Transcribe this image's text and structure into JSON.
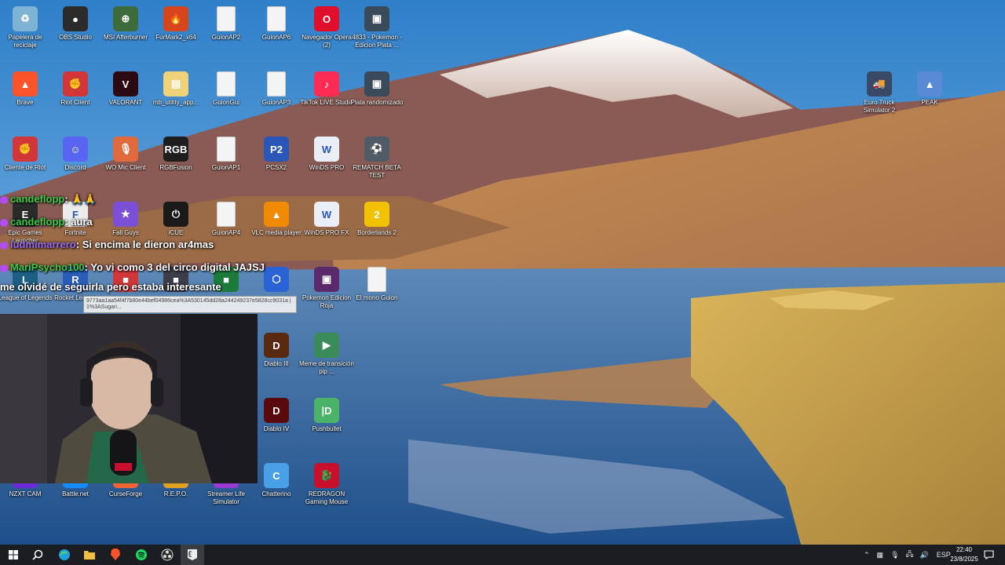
{
  "desktop": {
    "icons": [
      {
        "label": "Papelera de reciclaje",
        "icon": "recycle-bin-icon",
        "color": "#7fb3d6"
      },
      {
        "label": "OBS Studio",
        "icon": "obs-icon",
        "color": "#2b2b2b"
      },
      {
        "label": "MSI Afterburner",
        "icon": "msi-afterburner-icon",
        "color": "#3d6b3a"
      },
      {
        "label": "FurMark2_x64",
        "icon": "furmark-icon",
        "color": "#d6461c"
      },
      {
        "label": "GuionAP2",
        "icon": "file-icon",
        "color": "#f4f4f4"
      },
      {
        "label": "GuionAP6",
        "icon": "file-icon",
        "color": "#f4f4f4"
      },
      {
        "label": "Navegador Opera (2)",
        "icon": "opera-icon",
        "color": "#e0102d"
      },
      {
        "label": "4833 - Pokemon - Edicion Plata ...",
        "icon": "rom-icon",
        "color": "#3a4a5a"
      },
      {
        "label": "Brave",
        "icon": "brave-icon",
        "color": "#fb542b"
      },
      {
        "label": "Riot Client",
        "icon": "riot-client-icon",
        "color": "#d13639"
      },
      {
        "label": "VALORANT",
        "icon": "valorant-icon",
        "color": "#2b0a13"
      },
      {
        "label": "mb_utility_app...",
        "icon": "folder-zip-icon",
        "color": "#f0d27a"
      },
      {
        "label": "GuionGui",
        "icon": "file-icon",
        "color": "#f4f4f4"
      },
      {
        "label": "GuionAP3",
        "icon": "file-icon",
        "color": "#f4f4f4"
      },
      {
        "label": "TikTok LIVE Studio",
        "icon": "tiktok-live-icon",
        "color": "#fe2c55"
      },
      {
        "label": "Plata randomizado",
        "icon": "rom-icon",
        "color": "#3a4a5a"
      },
      {
        "label": "Cliente de Riot",
        "icon": "riot-client-icon",
        "color": "#d13639"
      },
      {
        "label": "Discord",
        "icon": "discord-icon",
        "color": "#5865f2"
      },
      {
        "label": "WO Mic Client",
        "icon": "microphone-icon",
        "color": "#e06a3b"
      },
      {
        "label": "RGBFusion",
        "icon": "rgb-fusion-icon",
        "color": "#1e1e1e"
      },
      {
        "label": "GuionAP1",
        "icon": "file-icon",
        "color": "#f4f4f4"
      },
      {
        "label": "PCSX2",
        "icon": "pcsx2-icon",
        "color": "#2a56b8"
      },
      {
        "label": "WinDS PRO",
        "icon": "winds-icon",
        "color": "#e9eef7"
      },
      {
        "label": "REMATCH BETA TEST",
        "icon": "rematch-icon",
        "color": "#4f5b66"
      },
      {
        "label": "Epic Games Launcher",
        "icon": "epic-games-icon",
        "color": "#2a2a2a"
      },
      {
        "label": "Fortnite",
        "icon": "fortnite-icon",
        "color": "#ececec"
      },
      {
        "label": "Fall Guys",
        "icon": "fall-guys-icon",
        "color": "#7b4fd6"
      },
      {
        "label": "iCUE",
        "icon": "icue-icon",
        "color": "#1a1a1a"
      },
      {
        "label": "GuionAP4",
        "icon": "file-icon",
        "color": "#f4f4f4"
      },
      {
        "label": "VLC media player",
        "icon": "vlc-icon",
        "color": "#f08a00"
      },
      {
        "label": "WinDS PRO FX",
        "icon": "winds-icon",
        "color": "#e9eef7"
      },
      {
        "label": "Borderlands 2",
        "icon": "borderlands-icon",
        "color": "#f2c200"
      },
      {
        "label": "League of Legends",
        "icon": "league-icon",
        "color": "#1c5f83"
      },
      {
        "label": "Rocket League",
        "icon": "rocket-league-icon",
        "color": "#2a5db8"
      },
      {
        "label": "",
        "icon": "app-red-icon",
        "color": "#d13639"
      },
      {
        "label": "",
        "icon": "app-dark-icon",
        "color": "#3c3c4a"
      },
      {
        "label": "",
        "icon": "app-green-icon",
        "color": "#1c7a3a"
      },
      {
        "label": "",
        "icon": "box-3d-icon",
        "color": "#2a63d6"
      },
      {
        "label": "Pokemon Edicion Roja",
        "icon": "rom-icon",
        "color": "#5a2a6a"
      },
      {
        "label": "El mono Guion",
        "icon": "file-icon",
        "color": "#f4f4f4"
      },
      {
        "label": "Diablo III",
        "icon": "diablo3-icon",
        "color": "#5a2a10"
      },
      {
        "label": "Meme de transición pip ...",
        "icon": "meme-icon",
        "color": "#3a8a5a"
      },
      {
        "label": "Diablo IV",
        "icon": "diablo4-icon",
        "color": "#5a0a0a"
      },
      {
        "label": "Pushbullet",
        "icon": "pushbullet-icon",
        "color": "#4ab367"
      },
      {
        "label": "NZXT CAM",
        "icon": "nzxt-icon",
        "color": "#6c2bd9"
      },
      {
        "label": "Battle.net",
        "icon": "battlenet-icon",
        "color": "#148eff"
      },
      {
        "label": "CurseForge",
        "icon": "curseforge-icon",
        "color": "#f16436"
      },
      {
        "label": "R.E.P.O.",
        "icon": "repo-icon",
        "color": "#e0a020"
      },
      {
        "label": "Streamer Life Simulator",
        "icon": "streamer-life-icon",
        "color": "#9a3ad6"
      },
      {
        "label": "Chatterino",
        "icon": "chatterino-icon",
        "color": "#4aa0e6"
      },
      {
        "label": "REDRAGON Gaming Mouse",
        "icon": "redragon-icon",
        "color": "#c8102e"
      },
      {
        "label": "Euro Truck Simulator 2",
        "icon": "euro-truck-icon",
        "color": "#3a4a66"
      },
      {
        "label": "PEAK",
        "icon": "peak-icon",
        "color": "#5a8ad6"
      }
    ],
    "tooltip": "9773aa1aa54f4f7b80e44bef04986cea%3A530145dd28a244249237e5828cc9031a |1%3ASugari..."
  },
  "chat": {
    "messages": [
      {
        "user": "candeflopp",
        "text": ": 🙏🙏",
        "user_color": "#3ec84a"
      },
      {
        "user": "candeflopp",
        "text": ": aura",
        "user_color": "#3ec84a"
      },
      {
        "user": "ludmimarrero",
        "text": ": Si encima le dieron ar4mas",
        "user_color": "#9b6bf0"
      },
      {
        "user": "MariPsycho100",
        "text": ": Yo vi como 3 del circo digital JAJSJ",
        "user_color": "#3ec84a"
      },
      {
        "user": "",
        "text": "me olvidé de seguirla pero estaba interesante",
        "user_color": "#3ec84a"
      }
    ]
  },
  "taskbar": {
    "items": [
      {
        "name": "start-button",
        "icon": "windows-logo-icon"
      },
      {
        "name": "search-button",
        "icon": "search-icon"
      },
      {
        "name": "edge-button",
        "icon": "edge-icon"
      },
      {
        "name": "file-explorer-button",
        "icon": "folder-icon"
      },
      {
        "name": "brave-button",
        "icon": "brave-icon"
      },
      {
        "name": "spotify-button",
        "icon": "spotify-icon"
      },
      {
        "name": "obs-button",
        "icon": "obs-icon"
      },
      {
        "name": "epic-games-button",
        "icon": "epic-games-icon"
      }
    ],
    "language": "ESP",
    "time": "22:40",
    "date": "23/8/2025"
  }
}
